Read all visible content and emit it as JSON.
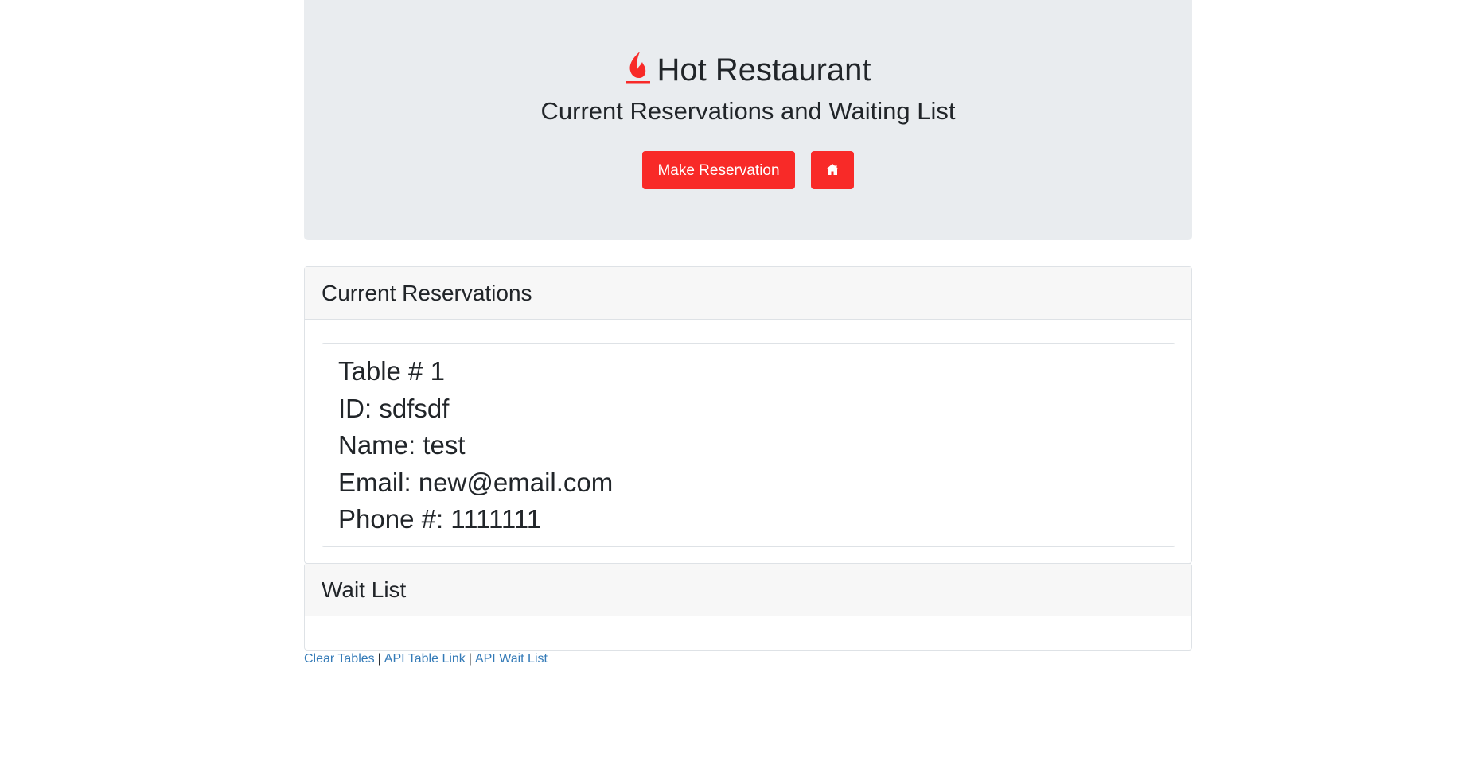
{
  "header": {
    "title": "Hot Restaurant",
    "subtitle": "Current Reservations and Waiting List",
    "make_reservation_label": "Make Reservation",
    "home_icon": "home-icon",
    "title_icon": "fire-icon",
    "accent_color": "#f82a28"
  },
  "reservations": {
    "heading": "Current Reservations",
    "tables": [
      {
        "table": "Table # 1",
        "id": "ID: sdfsdf",
        "name": "Name: test",
        "email": "Email: new@email.com",
        "phone": "Phone #: 1111111"
      }
    ]
  },
  "waitlist": {
    "heading": "Wait List"
  },
  "footer": {
    "clear_tables": "Clear Tables",
    "separator": "|",
    "api_table_link": "API Table Link",
    "api_wait_list": "API Wait List",
    "link_color": "#337ab7"
  }
}
